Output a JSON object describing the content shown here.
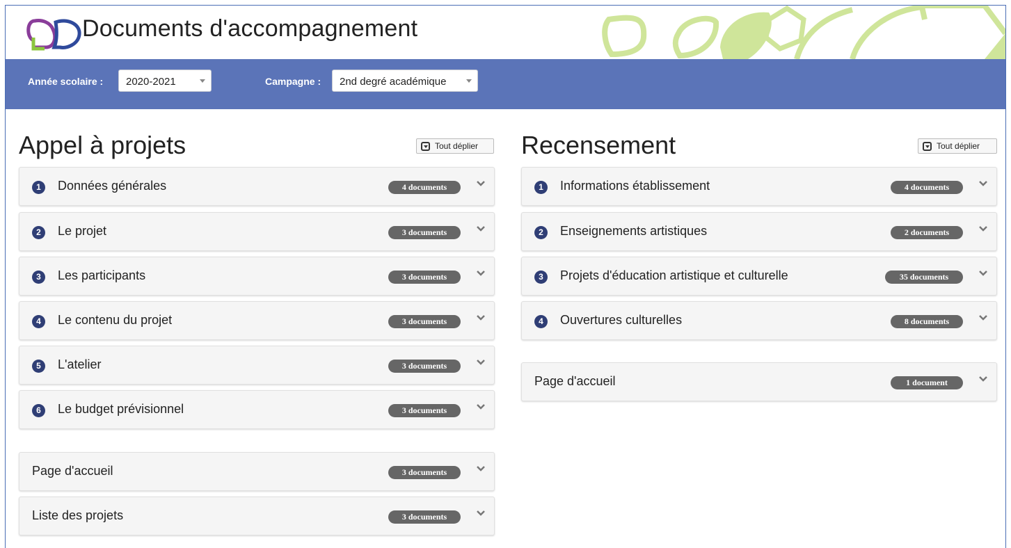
{
  "header": {
    "title": "Documents d'accompagnement",
    "brand_colors": {
      "purple": "#8a3d9a",
      "blue": "#2f4a9c",
      "green": "#8cc63f",
      "leaf": "#cfe59a"
    }
  },
  "filters": {
    "year_label": "Année scolaire :",
    "year_value": "2020-2021",
    "campaign_label": "Campagne :",
    "campaign_value": "2nd degré académique",
    "bar_color": "#5b74b8"
  },
  "left": {
    "title": "Appel à projets",
    "expand_label": "Tout déplier",
    "items": [
      {
        "num": "1",
        "label": "Données générales",
        "badge": "4 documents"
      },
      {
        "num": "2",
        "label": "Le projet",
        "badge": "3 documents"
      },
      {
        "num": "3",
        "label": "Les participants",
        "badge": "3 documents"
      },
      {
        "num": "4",
        "label": "Le contenu du projet",
        "badge": "3 documents"
      },
      {
        "num": "5",
        "label": "L'atelier",
        "badge": "3 documents"
      },
      {
        "num": "6",
        "label": "Le budget prévisionnel",
        "badge": "3 documents"
      }
    ],
    "extra": [
      {
        "label": "Page d'accueil",
        "badge": "3 documents"
      },
      {
        "label": "Liste des projets",
        "badge": "3 documents"
      }
    ]
  },
  "right": {
    "title": "Recensement",
    "expand_label": "Tout déplier",
    "items": [
      {
        "num": "1",
        "label": "Informations établissement",
        "badge": "4 documents"
      },
      {
        "num": "2",
        "label": "Enseignements artistiques",
        "badge": "2 documents"
      },
      {
        "num": "3",
        "label": "Projets d'éducation artistique et culturelle",
        "badge": "35 documents"
      },
      {
        "num": "4",
        "label": "Ouvertures culturelles",
        "badge": "8 documents"
      }
    ],
    "extra": [
      {
        "label": "Page d'accueil",
        "badge": "1 document"
      }
    ]
  }
}
